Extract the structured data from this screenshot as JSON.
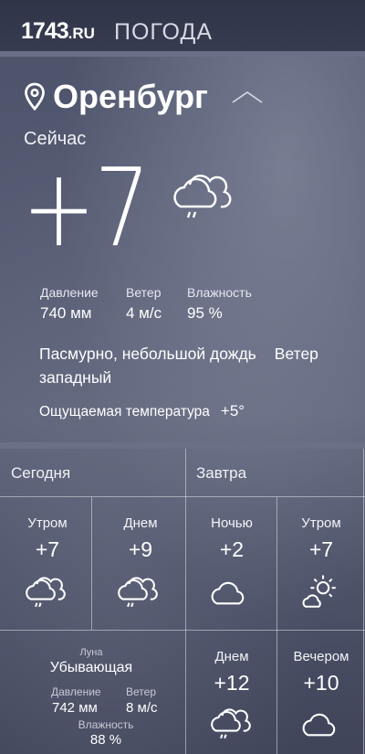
{
  "header": {
    "logo_number": "1743",
    "logo_suffix": ".RU",
    "section_title": "ПОГОДА"
  },
  "current": {
    "city": "Оренбург",
    "now_label": "Сейчас",
    "temperature": "+7",
    "icon": "cloud-rain-icon",
    "stats": [
      {
        "label": "Давление",
        "value": "740 мм"
      },
      {
        "label": "Ветер",
        "value": "4 м/с"
      },
      {
        "label": "Влажность",
        "value": "95 %"
      }
    ],
    "condition": "Пасмурно, небольшой дождь",
    "wind_dir_label": "Ветер",
    "wind_dir_value": "западный",
    "feels_label": "Ощущаемая температура",
    "feels_value": "+5°"
  },
  "today": {
    "title": "Сегодня",
    "periods": [
      {
        "label": "Утром",
        "temp": "+7",
        "icon": "cloud-rain-icon"
      },
      {
        "label": "Днем",
        "temp": "+9",
        "icon": "cloud-rain-icon"
      }
    ],
    "moon_label": "Луна",
    "moon_phase": "Убывающая",
    "pressure_label": "Давление",
    "pressure_value": "742 мм",
    "wind_label": "Ветер",
    "wind_value": "8 м/с",
    "humidity_label": "Влажность",
    "humidity_value": "88 %"
  },
  "tomorrow": {
    "title": "Завтра",
    "periods": [
      {
        "label": "Ночью",
        "temp": "+2",
        "icon": "cloud-icon"
      },
      {
        "label": "Утром",
        "temp": "+7",
        "icon": "sun-cloud-icon"
      },
      {
        "label": "Днем",
        "temp": "+12",
        "icon": "cloud-rain-icon"
      },
      {
        "label": "Вечером",
        "temp": "+10",
        "icon": "cloud-icon"
      }
    ]
  }
}
